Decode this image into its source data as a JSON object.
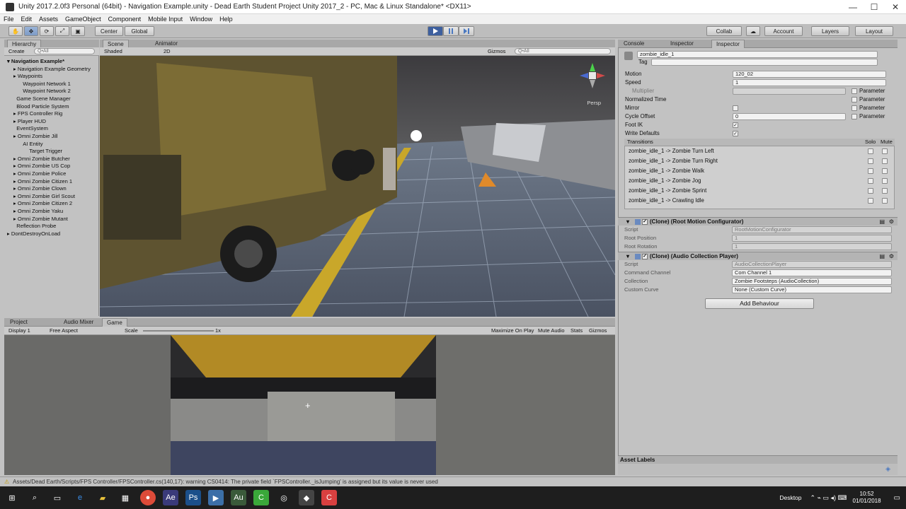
{
  "window": {
    "title": "Unity 2017.2.0f3 Personal (64bit) - Navigation Example.unity - Dead Earth Student Project Unity 2017_2 - PC, Mac & Linux Standalone* <DX11>",
    "controls": [
      "—",
      "☐",
      "✕"
    ]
  },
  "menu": [
    "File",
    "Edit",
    "Assets",
    "GameObject",
    "Component",
    "Mobile Input",
    "Window",
    "Help"
  ],
  "toolbar": {
    "pivot": "Center",
    "space": "Global",
    "play_state": "paused",
    "collab": "Collab",
    "account": "Account",
    "layers": "Layers",
    "layout": "Layout"
  },
  "hierarchy": {
    "tab": "Hierarchy",
    "create": "Create",
    "search_placeholder": "Q•All",
    "items": [
      {
        "label": "Navigation Example*",
        "indent": 0,
        "bold": true
      },
      {
        "label": "Navigation Example Geometry",
        "indent": 1
      },
      {
        "label": "Waypoints",
        "indent": 1
      },
      {
        "label": "Waypoint Network 1",
        "indent": 2
      },
      {
        "label": "Waypoint Network 2",
        "indent": 2
      },
      {
        "label": "Game Scene Manager",
        "indent": 1
      },
      {
        "label": "Blood Particle System",
        "indent": 1
      },
      {
        "label": "FPS Controller Rig",
        "indent": 1
      },
      {
        "label": "Player HUD",
        "indent": 1
      },
      {
        "label": "EventSystem",
        "indent": 1
      },
      {
        "label": "Omni Zombie Jill",
        "indent": 1
      },
      {
        "label": "AI Entity",
        "indent": 2
      },
      {
        "label": "Target Trigger",
        "indent": 3
      },
      {
        "label": "Omni Zombie Butcher",
        "indent": 1
      },
      {
        "label": "Omni Zombie US Cop",
        "indent": 1
      },
      {
        "label": "Omni Zombie Police",
        "indent": 1
      },
      {
        "label": "Omni Zombie Citizen 1",
        "indent": 1
      },
      {
        "label": "Omni Zombie Clown",
        "indent": 1
      },
      {
        "label": "Omni Zombie Girl Scout",
        "indent": 1
      },
      {
        "label": "Omni Zombie Citizen 2",
        "indent": 1
      },
      {
        "label": "Omni Zombie Yaku",
        "indent": 1
      },
      {
        "label": "Omni Zombie Mutant",
        "indent": 1
      },
      {
        "label": "Reflection Probe",
        "indent": 1
      },
      {
        "label": "DontDestroyOnLoad",
        "indent": 0
      }
    ]
  },
  "scene": {
    "tabs": [
      "Scene",
      "Animator"
    ],
    "shading": "Shaded",
    "mode_2d": "2D",
    "gizmos": "Gizmos",
    "search_placeholder": "Q•All",
    "persp": "Persp"
  },
  "game": {
    "tabs": [
      "Project",
      "Audio Mixer",
      "Game"
    ],
    "display": "Display 1",
    "aspect": "Free Aspect",
    "scale_label": "Scale",
    "scale_value": "1x",
    "buttons": [
      "Maximize On Play",
      "Mute Audio",
      "Stats",
      "Gizmos"
    ]
  },
  "inspector": {
    "tabs": [
      "Console",
      "Inspector",
      "Inspector"
    ],
    "object_name": "zombie_idle_1",
    "tag_label": "Tag",
    "fields": [
      {
        "label": "Motion",
        "value": "120_02"
      },
      {
        "label": "Speed",
        "value": "1"
      },
      {
        "label": "Multiplier",
        "value": ""
      },
      {
        "label": "Normalized Time",
        "value": ""
      },
      {
        "label": "Mirror",
        "value": ""
      },
      {
        "label": "Cycle Offset",
        "value": "0"
      },
      {
        "label": "Foot IK",
        "value": "✓"
      },
      {
        "label": "Write Defaults",
        "value": "✓"
      }
    ],
    "parameter_label": "Parameter",
    "transitions_header": "Transitions",
    "solo": "Solo",
    "mute": "Mute",
    "transitions": [
      "zombie_idle_1 -> Zombie Turn Left",
      "zombie_idle_1 -> Zombie Turn Right",
      "zombie_idle_1 -> Zombie Walk",
      "zombie_idle_1 -> Zombie Jog",
      "zombie_idle_1 -> Zombie Sprint",
      "zombie_idle_1 -> Crawling Idle"
    ],
    "components": [
      {
        "title": "(Clone) (Root Motion Configurator)",
        "rows": [
          {
            "label": "Script",
            "value": "RootMotionConfigurator"
          },
          {
            "label": "Root Position",
            "value": "1"
          },
          {
            "label": "Root Rotation",
            "value": "1"
          }
        ]
      },
      {
        "title": "(Clone) (Audio Collection Player)",
        "rows": [
          {
            "label": "Script",
            "value": "AudioCollectionPlayer"
          },
          {
            "label": "Command Channel",
            "value": "Com Channel 1"
          },
          {
            "label": "Collection",
            "value": "Zombie Footsteps (AudioCollection)"
          },
          {
            "label": "Custom Curve",
            "value": "None (Custom Curve)"
          }
        ]
      }
    ],
    "add_behaviour": "Add Behaviour",
    "asset_labels": "Asset Labels"
  },
  "status": "Assets/Dead Earth/Scripts/FPS Controller/FPSController.cs(140,17): warning CS0414: The private field `FPSController._isJumping' is assigned but its value is never used",
  "taskbar": {
    "desktop": "Desktop",
    "time": "10:52",
    "date": "01/01/2018"
  },
  "colors": {
    "unity_bg": "#c2c2c2",
    "play_blue": "#4a78c0",
    "taskbar": "#1e1e1e"
  }
}
